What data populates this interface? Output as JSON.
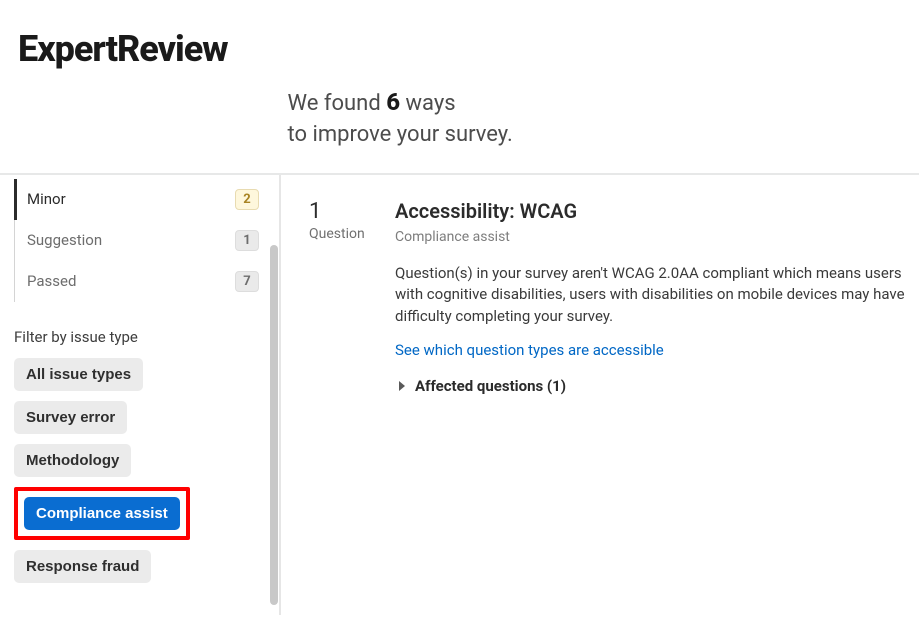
{
  "header": {
    "brand": "ExpertReview",
    "found_prefix": "We found ",
    "found_count": "6",
    "found_suffix": " ways",
    "found_line2": "to improve your survey."
  },
  "sidebar": {
    "severity": {
      "minor": {
        "label": "Minor",
        "count": "2"
      },
      "suggestion": {
        "label": "Suggestion",
        "count": "1"
      },
      "passed": {
        "label": "Passed",
        "count": "7"
      }
    },
    "filter_title": "Filter by issue type",
    "filters": {
      "all": "All issue types",
      "survey_error": "Survey error",
      "methodology": "Methodology",
      "compliance": "Compliance assist",
      "fraud": "Response fraud"
    }
  },
  "main": {
    "question_num": "1",
    "question_label": "Question",
    "issue_title": "Accessibility: WCAG",
    "issue_category": "Compliance assist",
    "issue_desc": "Question(s) in your survey aren't WCAG 2.0AA compliant which means users with cognitive disabilities, users with disabilities on mobile devices may have difficulty completing your survey.",
    "issue_link": "See which question types are accessible",
    "affected_label": "Affected questions (1)"
  }
}
